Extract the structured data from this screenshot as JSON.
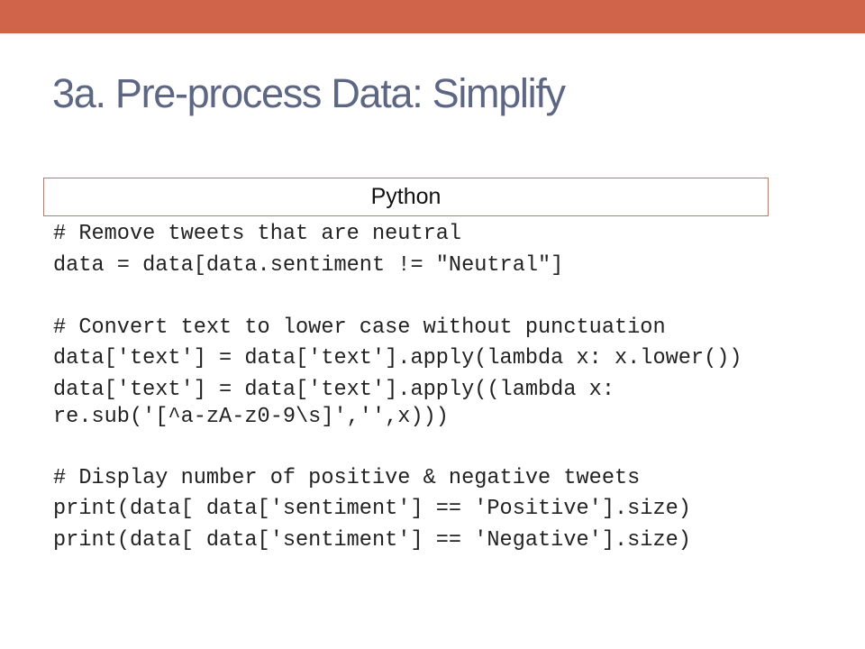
{
  "slide": {
    "title": "3a. Pre-process Data: Simplify",
    "code_label": "Python",
    "code_lines": [
      "# Remove tweets that are neutral",
      "data = data[data.sentiment != \"Neutral\"]",
      "# Convert text to lower case without punctuation",
      "data['text'] = data['text'].apply(lambda x: x.lower())",
      "data['text'] = data['text'].apply((lambda x:",
      "re.sub('[^a-zA-z0-9\\s]','',x)))",
      "# Display number of positive & negative tweets",
      "print(data[ data['sentiment'] == 'Positive'].size)",
      "print(data[ data['sentiment'] == 'Negative'].size)"
    ]
  },
  "colors": {
    "accent": "#d0644a",
    "title": "#5d6682"
  }
}
